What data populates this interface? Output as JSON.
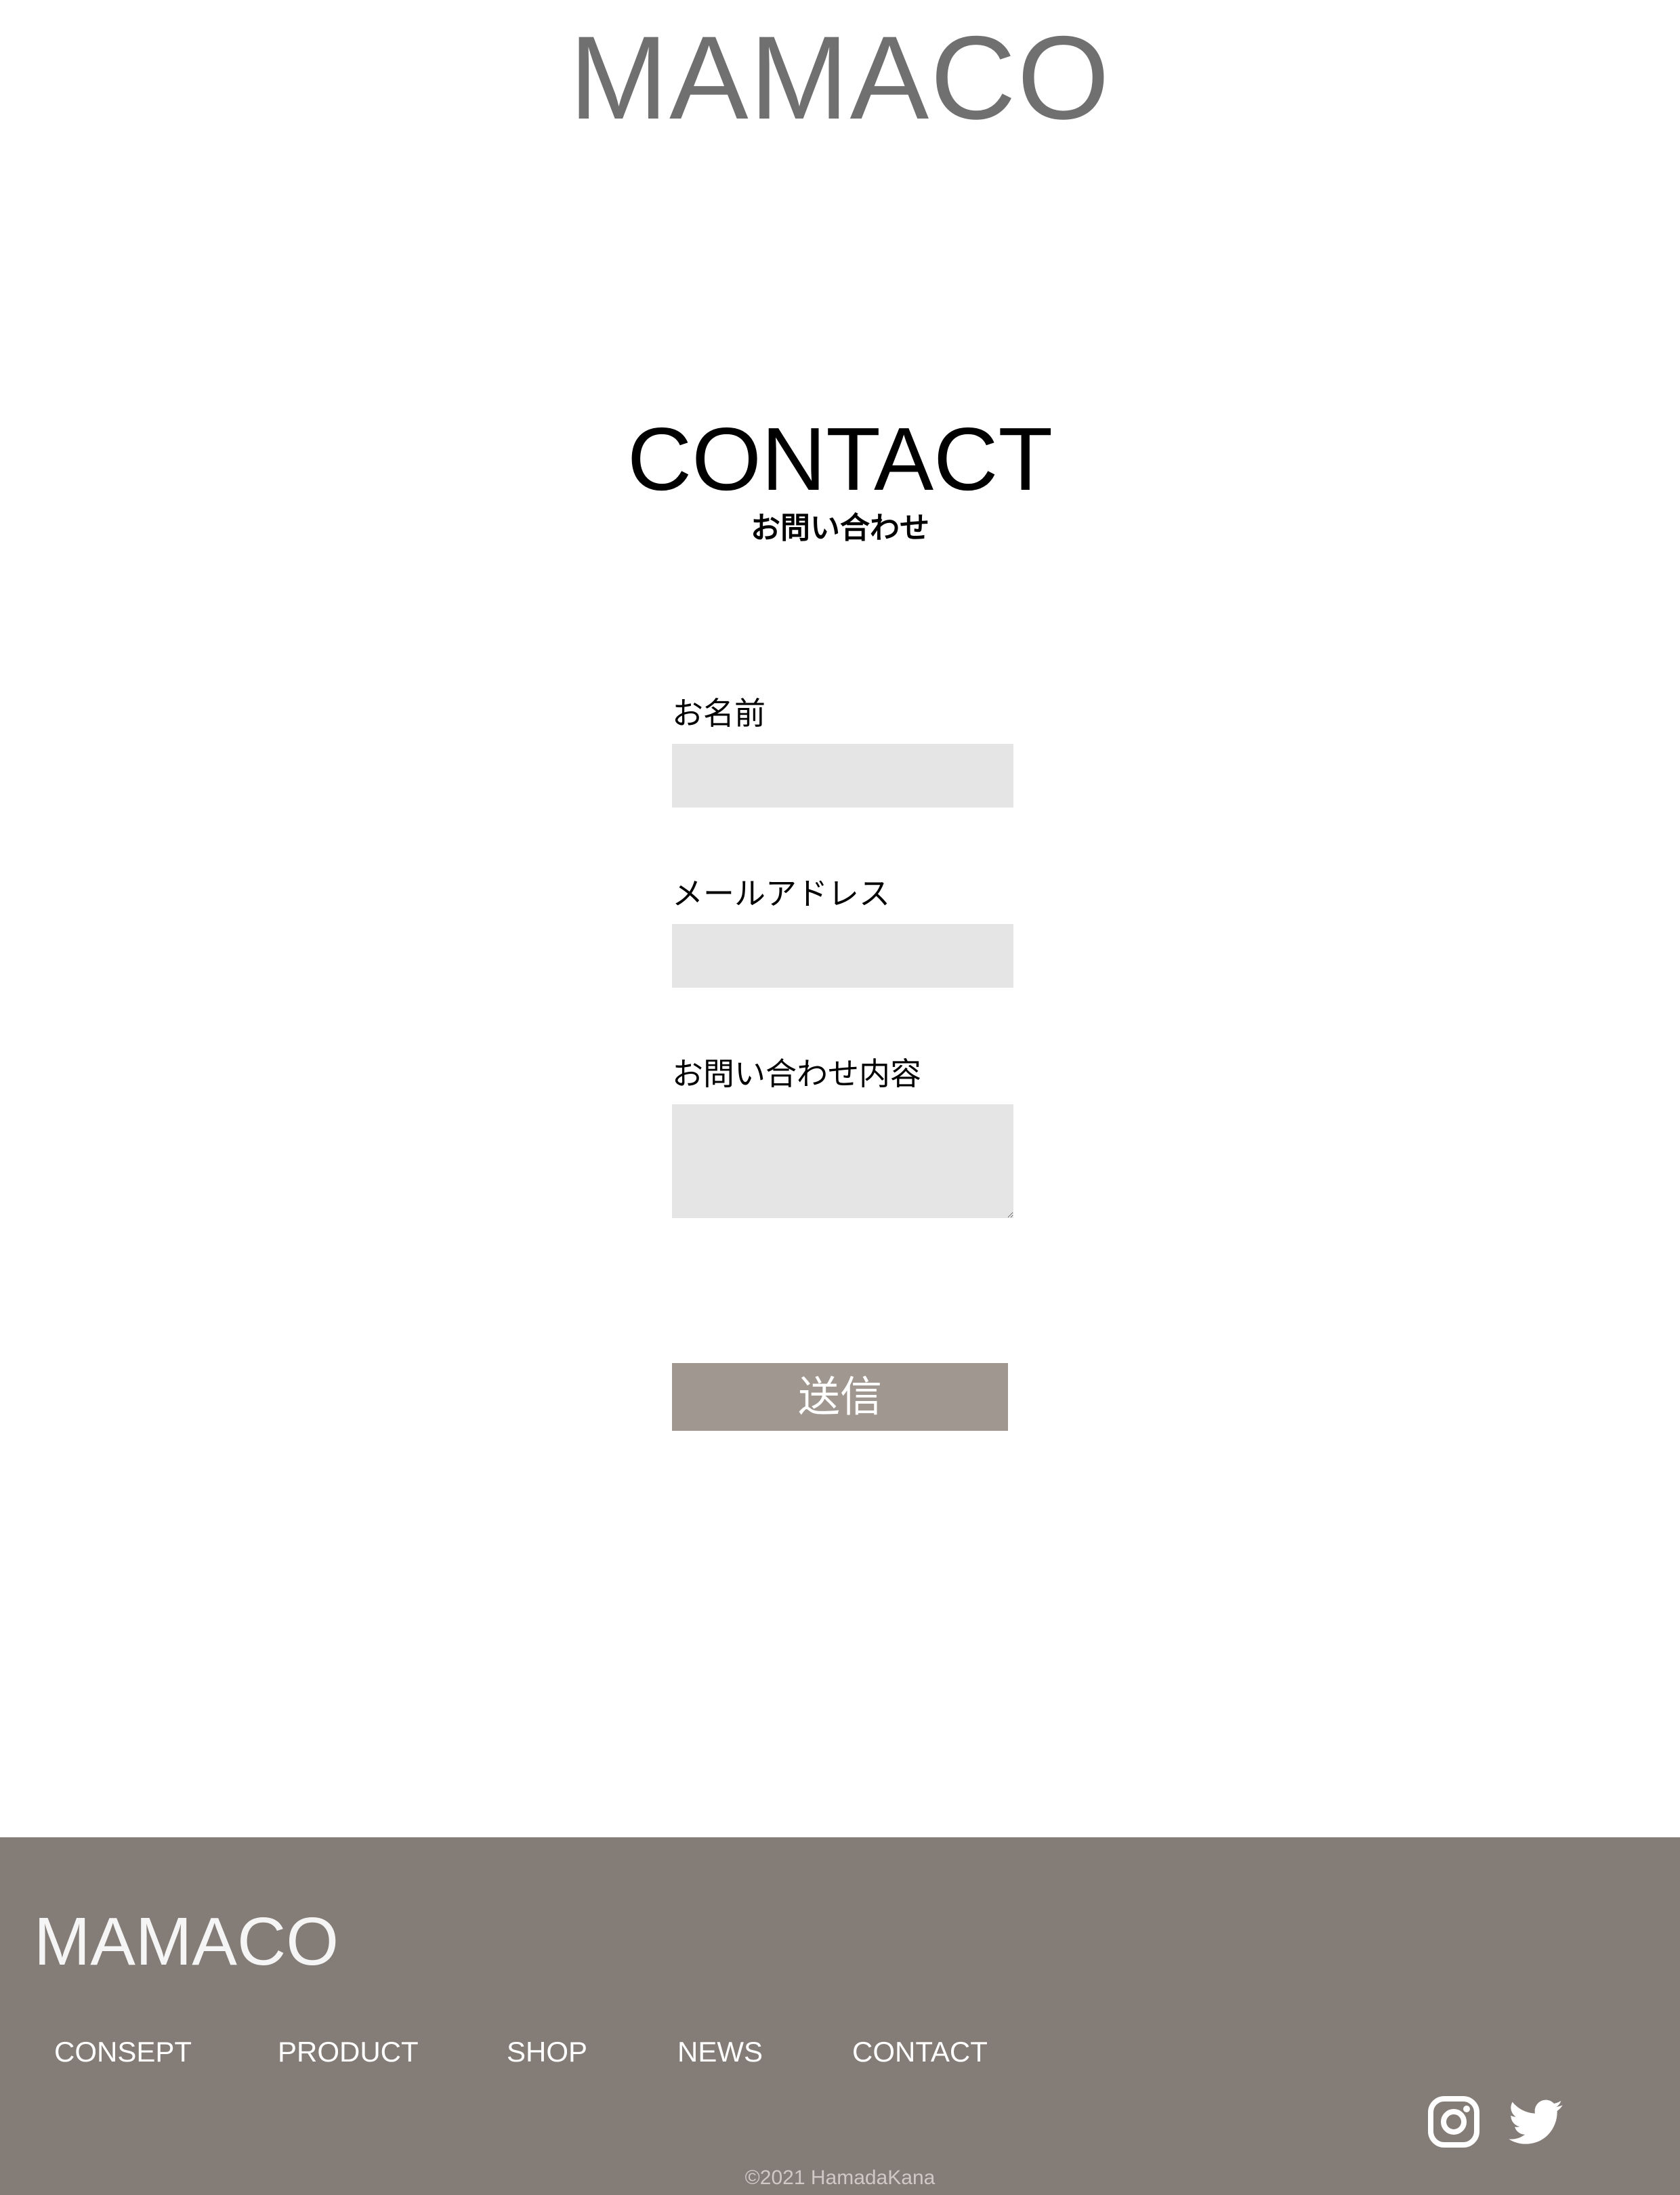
{
  "header": {
    "logo": "MAMACO"
  },
  "page": {
    "title": "CONTACT",
    "subtitle": "お問い合わせ"
  },
  "form": {
    "name_label": "お名前",
    "name_value": "",
    "email_label": "メールアドレス",
    "email_value": "",
    "message_label": "お問い合わせ内容",
    "message_value": "",
    "submit_label": "送信"
  },
  "footer": {
    "logo": "MAMACO",
    "nav": [
      {
        "label": "CONSEPT"
      },
      {
        "label": "PRODUCT"
      },
      {
        "label": "SHOP"
      },
      {
        "label": "NEWS"
      },
      {
        "label": "CONTACT"
      }
    ],
    "social": [
      "instagram-icon",
      "twitter-icon"
    ],
    "copyright": "©2021 HamadaKana"
  },
  "colors": {
    "logo_text": "#707070",
    "input_background": "#e5e5e5",
    "submit_background": "#a09890",
    "footer_background": "#847c76"
  }
}
